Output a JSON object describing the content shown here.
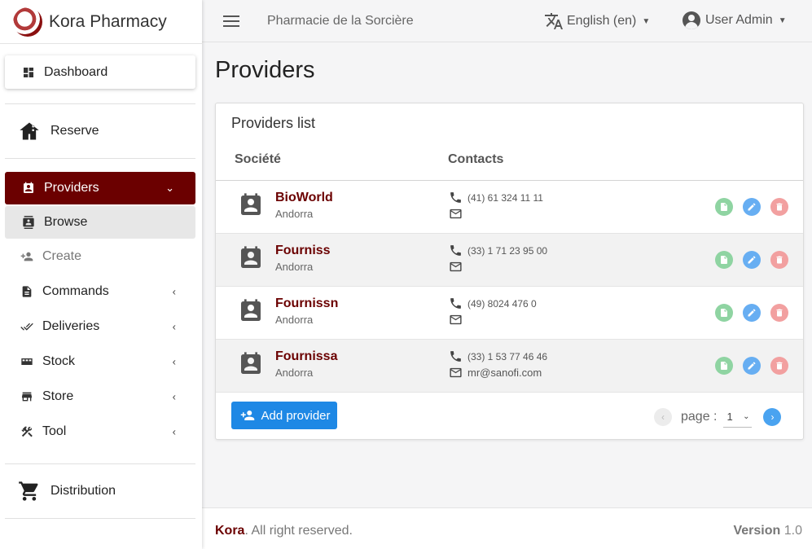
{
  "brand": {
    "title": "Kora Pharmacy"
  },
  "sidebar": {
    "dashboard": "Dashboard",
    "reserve": "Reserve",
    "providers": "Providers",
    "browse": "Browse",
    "create": "Create",
    "commands": "Commands",
    "deliveries": "Deliveries",
    "stock": "Stock",
    "store": "Store",
    "tool": "Tool",
    "distribution": "Distribution"
  },
  "header": {
    "pharmacy": "Pharmacie de la Sorcière",
    "language": "English (en)",
    "user": "User Admin"
  },
  "main": {
    "title": "Providers",
    "panel_title": "Providers list",
    "col_company": "Société",
    "col_contacts": "Contacts",
    "rows": [
      {
        "name": "BioWorld",
        "country": "Andorra",
        "phone": "(41) 61 324 11 11",
        "email": ""
      },
      {
        "name": "Fourniss",
        "country": "Andorra",
        "phone": "(33) 1 71 23 95 00",
        "email": ""
      },
      {
        "name": "Fournissn",
        "country": "Andorra",
        "phone": "(49) 8024 476 0",
        "email": ""
      },
      {
        "name": "Fournissa",
        "country": "Andorra",
        "phone": "(33) 1 53 77 46 46",
        "email": "mr@sanofi.com"
      }
    ],
    "add_button": "Add provider",
    "page_label": "page :",
    "page_value": "1"
  },
  "footer": {
    "brand": "Kora",
    "rights": ". All right reserved.",
    "version_label": "Version",
    "version": "1.0"
  },
  "colors": {
    "accent": "#6b0000",
    "primary": "#1e88e5"
  }
}
